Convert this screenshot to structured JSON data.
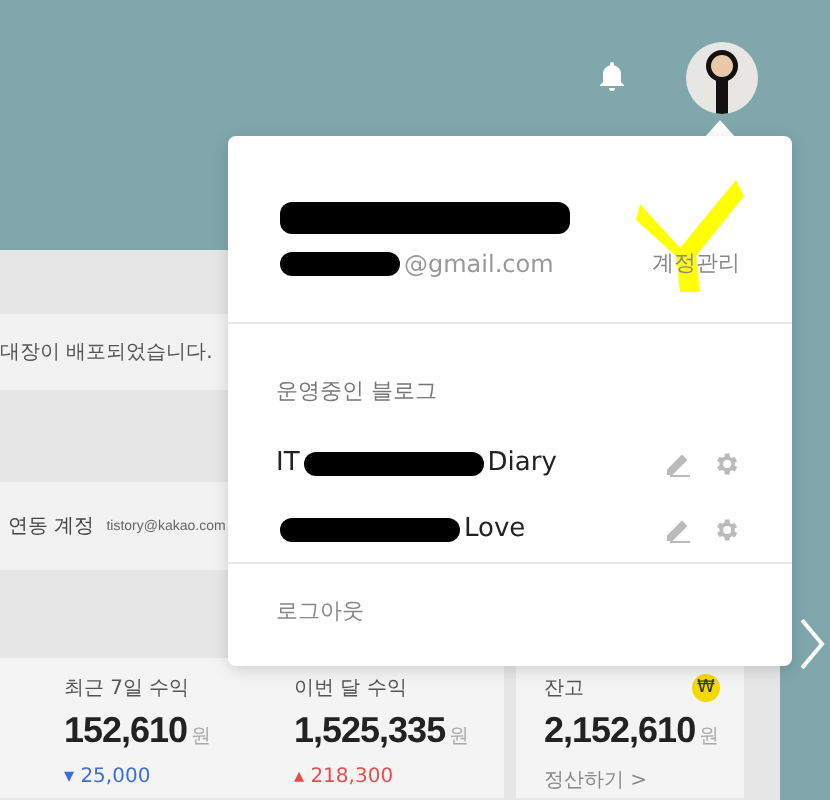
{
  "account_menu": {
    "name_parts": [
      {
        "kind": "redacted"
      }
    ],
    "email_parts": [
      {
        "kind": "redacted"
      },
      {
        "kind": "text",
        "text": "@gmail.com"
      }
    ],
    "manage_link": "계정관리",
    "section_title": "운영중인 블로그",
    "blogs": [
      {
        "name_parts": [
          {
            "kind": "text",
            "text": "IT"
          },
          {
            "kind": "redacted"
          },
          {
            "kind": "text",
            "text": "Diary"
          }
        ]
      },
      {
        "name_parts": [
          {
            "kind": "redacted"
          },
          {
            "kind": "text",
            "text": "Love"
          }
        ]
      }
    ],
    "logout": "로그아웃"
  },
  "dashboard": {
    "notice": "대장이 배포되었습니다.",
    "linked_account": {
      "label": "연동 계정",
      "value": "tistory@kakao.com"
    },
    "stats": [
      {
        "label": "최근 7일 수익",
        "value": "152,610",
        "unit": "원",
        "change": "▾ 25,000",
        "color": "#3b6de0"
      },
      {
        "label": "이번 달 수익",
        "value": "1,525,335",
        "unit": "원",
        "change": "▴ 218,300",
        "color": "#e84c4c"
      }
    ],
    "balance": {
      "label": "잔고",
      "value": "2,152,610",
      "unit": "원",
      "action": "정산하기 >",
      "badge": "₩"
    }
  }
}
